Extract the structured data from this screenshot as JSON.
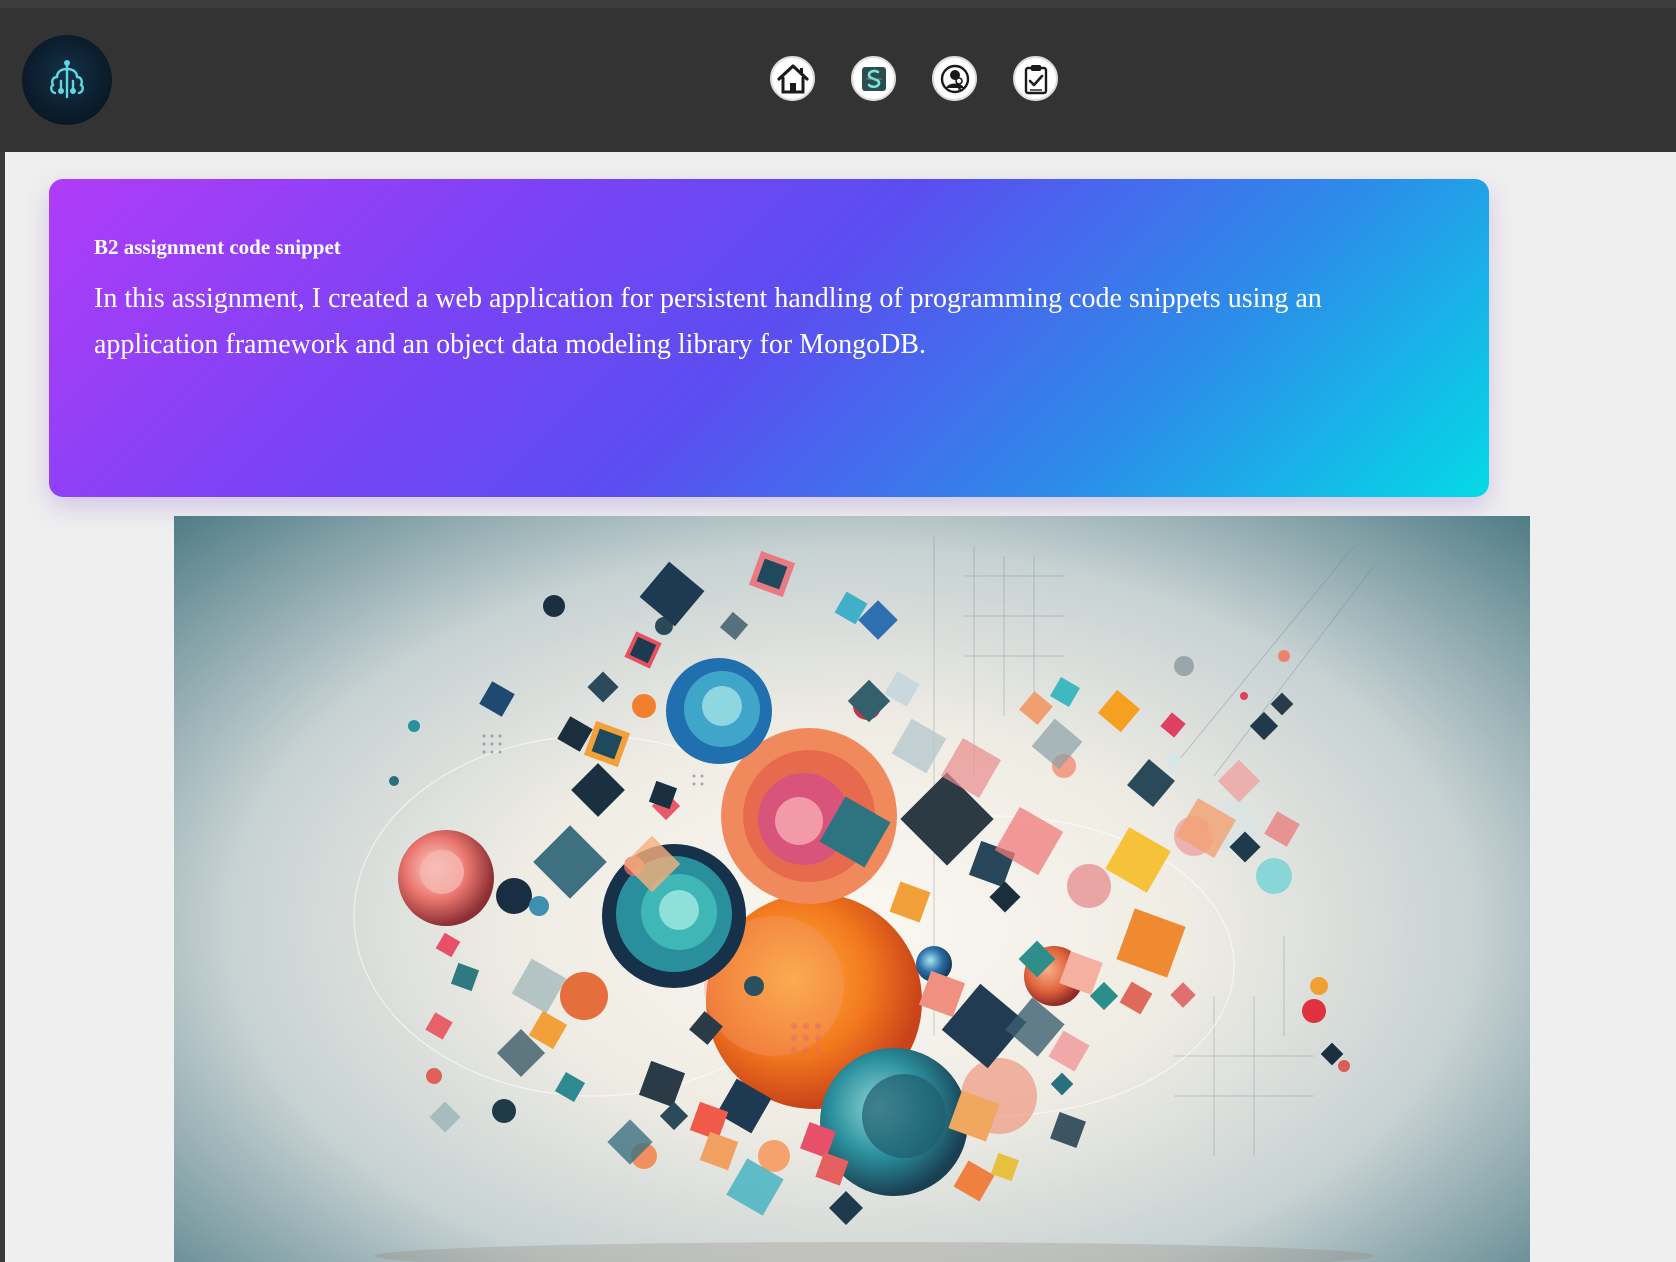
{
  "header": {
    "logo_icon": "brain-circuit-logo-icon",
    "nav": [
      {
        "name": "home",
        "icon": "home-icon"
      },
      {
        "name": "snippets",
        "icon": "snippet-logo-icon"
      },
      {
        "name": "login",
        "icon": "user-key-icon"
      },
      {
        "name": "assignment",
        "icon": "clipboard-check-icon"
      }
    ]
  },
  "card": {
    "title": "B2 assignment code snippet",
    "text": "In this assignment, I created a web application for persistent handling of programming code snippets using an application framework and an object data modeling library for MongoDB.",
    "gradient_start": "#b03cf9",
    "gradient_mid": "#5a4ef0",
    "gradient_end": "#04dae6"
  },
  "hero": {
    "description_icon": "abstract-geometric-art-image"
  },
  "colors": {
    "header_bg": "#333333",
    "page_bg": "#efefef"
  }
}
